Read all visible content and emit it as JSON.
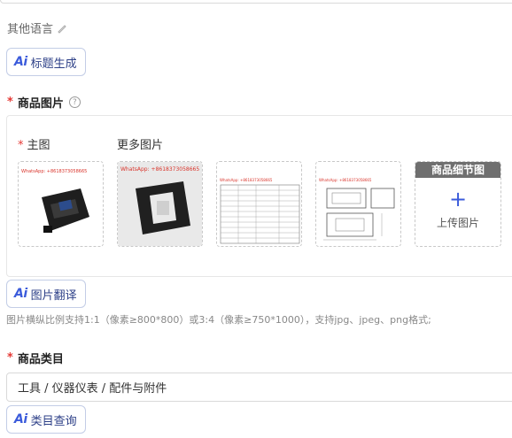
{
  "other_language": {
    "label": "其他语言"
  },
  "ai_buttons": {
    "ai_mark": "Ai",
    "title_generate": "标题生成",
    "image_translate": "图片翻译",
    "category_query": "类目查询"
  },
  "product_images": {
    "required_mark": "*",
    "label": "商品图片",
    "help_icon": "question-circle-icon",
    "main_label": "主图",
    "more_label": "更多图片",
    "thumb_watermarks": [
      "WhatsApp: +8618373058665",
      "WhatsApp: +8618373058665",
      "WhatsApp: +8618373058665",
      "WhatsApp: +8618373058665"
    ],
    "detail_header": "商品细节图",
    "upload_plus": "+",
    "upload_label": "上传图片",
    "hint": "图片横纵比例支持1:1（像素≥800*800）或3:4（像素≥750*1000），支持jpg、jpeg、png格式;"
  },
  "product_category": {
    "required_mark": "*",
    "label": "商品类目",
    "value": "工具 / 仪器仪表 / 配件与附件"
  },
  "colors": {
    "accent": "#3b5bdb",
    "required": "#e53935",
    "watermark": "#d9342b"
  }
}
